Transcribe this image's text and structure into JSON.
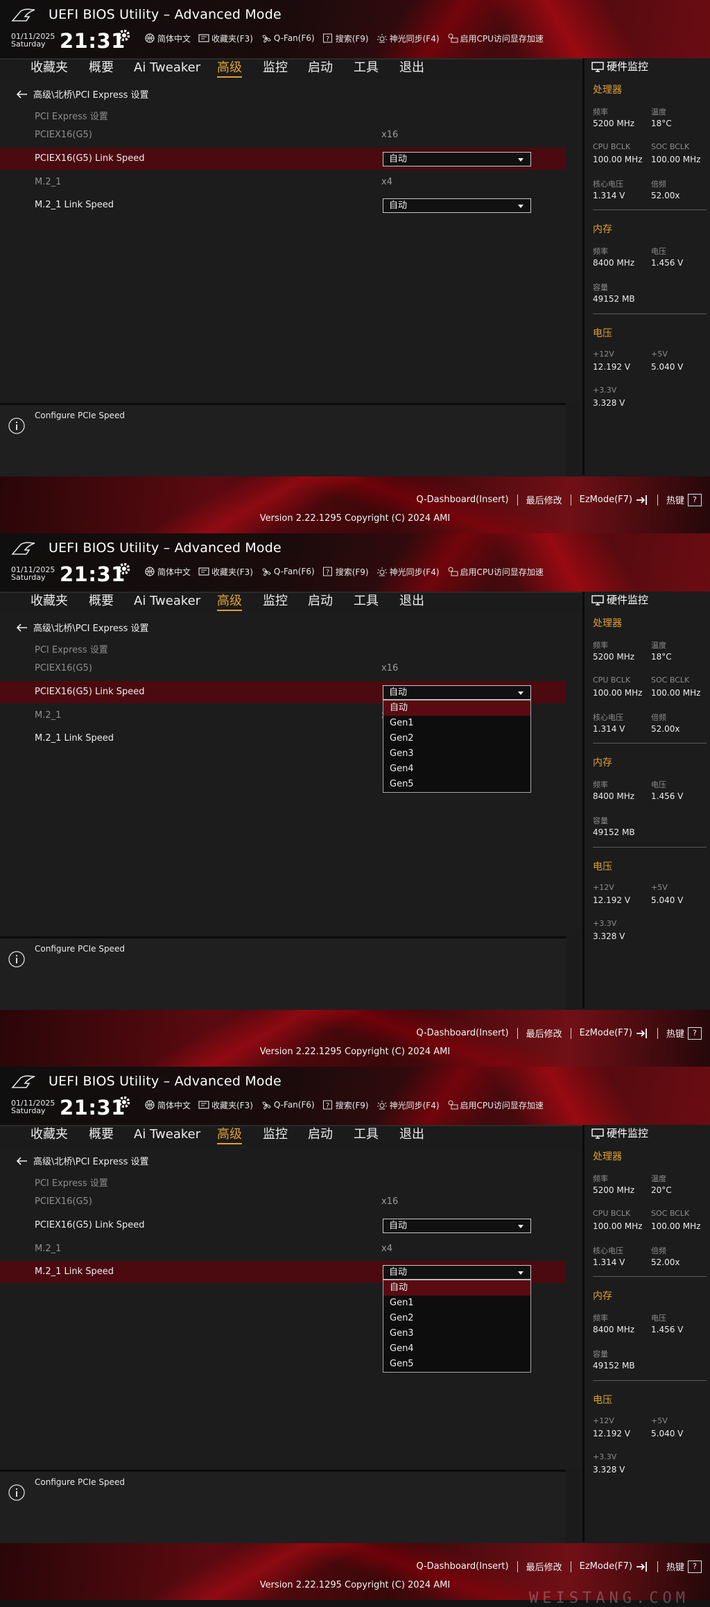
{
  "app_title": "UEFI BIOS Utility – Advanced Mode",
  "date": "01/11/2025",
  "day": "Saturday",
  "time": "21:31",
  "toolbar": [
    {
      "label": "简体中文",
      "icon": "globe-icon"
    },
    {
      "label": "收藏夹(F3)",
      "icon": "favorites-icon"
    },
    {
      "label": "Q-Fan(F6)",
      "icon": "fan-icon"
    },
    {
      "label": "搜索(F9)",
      "icon": "help-search-icon"
    },
    {
      "label": "神光同步(F4)",
      "icon": "aura-icon"
    },
    {
      "label": "启用CPU访问显存加速",
      "icon": "resizable-bar-icon"
    }
  ],
  "nav_tabs": [
    "收藏夹",
    "概要",
    "Ai Tweaker",
    "高级",
    "监控",
    "启动",
    "工具",
    "退出"
  ],
  "active_tab": "高级",
  "breadcrumb": "高级\\北桥\\PCI Express 设置",
  "section_label": "PCI Express 设置",
  "settings": {
    "pciex16": {
      "label": "PCIEX16(G5)",
      "value": "x16"
    },
    "pciex16_speed": {
      "label": "PCIEX16(G5) Link Speed",
      "value": "自动"
    },
    "m2": {
      "label": "M.2_1",
      "value": "x4"
    },
    "m2_speed": {
      "label": "M.2_1 Link Speed",
      "value": "自动"
    }
  },
  "dropdown_options": [
    "自动",
    "Gen1",
    "Gen2",
    "Gen3",
    "Gen4",
    "Gen5"
  ],
  "help_text": "Configure PCIe Speed",
  "hw_monitor": {
    "title": "硬件监控",
    "cpu": {
      "section": "处理器",
      "freq_label": "频率",
      "freq": "5200 MHz",
      "temp_label": "温度",
      "cpu_bclk_label": "CPU BCLK",
      "cpu_bclk": "100.00 MHz",
      "soc_bclk_label": "SOC BCLK",
      "soc_bclk": "100.00 MHz",
      "vcore_label": "核心电压",
      "vcore": "1.314 V",
      "ratio_label": "倍频",
      "ratio": "52.00x"
    },
    "memory": {
      "section": "内存",
      "freq_label": "频率",
      "freq": "8400 MHz",
      "volt_label": "电压",
      "volt": "1.456 V",
      "cap_label": "容量",
      "cap": "49152 MB"
    },
    "voltage": {
      "section": "电压",
      "v12_label": "+12V",
      "v12": "12.192 V",
      "v5_label": "+5V",
      "v5": "5.040 V",
      "v33_label": "+3.3V",
      "v33": "3.328 V"
    }
  },
  "screens": [
    {
      "id": "s1",
      "highlight": "pciex16_speed",
      "dropdown": null,
      "temp": "18°C"
    },
    {
      "id": "s2",
      "highlight": "pciex16_speed",
      "dropdown": "pciex16_speed",
      "temp": "18°C"
    },
    {
      "id": "s3",
      "highlight": "m2_speed",
      "dropdown": "m2_speed",
      "temp": "20°C"
    }
  ],
  "bottom_bar": {
    "qdashboard": "Q-Dashboard(Insert)",
    "last_changes": "最后修改",
    "ezmode": "EzMode(F7)",
    "hotkeys": "热键",
    "hotkeys_key": "?",
    "copyright": "Version 2.22.1295 Copyright (C) 2024 AMI"
  },
  "watermark": "WEISTANG.COM",
  "colors": {
    "accent": "#e0a030",
    "highlight": "#4b0a10",
    "brand_red": "#c0101c"
  }
}
